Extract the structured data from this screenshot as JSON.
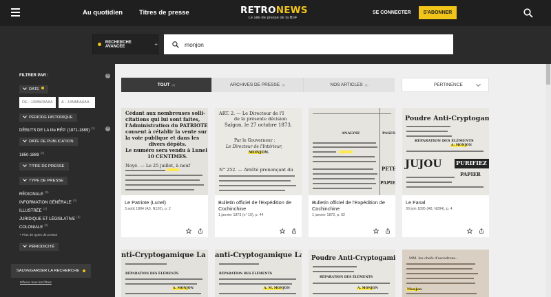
{
  "header": {
    "nav_daily": "Au quotidien",
    "nav_titles": "Titres de presse",
    "logo_retro": "RETRO",
    "logo_news": "NEWS",
    "logo_sub": "Le site de presse de la BnF",
    "connect": "SE CONNECTER",
    "subscribe": "S'ABONNER",
    "icons": [
      "menu-icon",
      "search-icon"
    ],
    "accent": "#f0c419"
  },
  "search": {
    "advanced_label": "RECHERCHE AVANCÉE",
    "advanced_plus": "+",
    "query": "monjon"
  },
  "sidebar": {
    "filter_by": "FILTRER PAR :",
    "date_pill": "DATE",
    "date_from_placeholder": "DE : JJ/MM/AAAA",
    "date_to_placeholder": "À : JJ/MM/AAAA",
    "period_pill": "PÉRIODE HISTORIQUE",
    "period_selected": "DÉBUTS DE LA IIIe RÉP. (1871-1889)",
    "period_selected_count": "(1)",
    "pub_date_pill": "DATE DE PUBLICATION",
    "pub_date_range": "1850-1889",
    "pub_date_count": "(6)",
    "press_title_pill": "TITRE DE PRESSE",
    "press_type_pill": "TYPE DE PRESSE",
    "press_types": [
      {
        "label": "RÉGIONALE",
        "count": "(5)"
      },
      {
        "label": "INFORMATION GÉNÉRALE",
        "count": "(4)"
      },
      {
        "label": "ILLUSTRÉE",
        "count": "(4)"
      },
      {
        "label": "JURIDIQUE ET LÉGISLATIVE",
        "count": "(2)"
      },
      {
        "label": "COLONIALE",
        "count": "(2)"
      }
    ],
    "more_types": "+  Plus de types de presse",
    "periodicity_pill": "PÉRIODICITÉ",
    "save_search": "SAUVEGARDER LA RECHERCHE",
    "clear_filters": "Effacer tous les filtres"
  },
  "tabs": [
    {
      "label": "TOUT",
      "count": "(6)",
      "active": true
    },
    {
      "label": "ARCHIVES DE PRESSE",
      "count": "(6)",
      "active": false
    },
    {
      "label": "NOS ARTICLES",
      "count": "(0)",
      "active": false
    }
  ],
  "sort": {
    "label": "PERTINENCE"
  },
  "results": [
    {
      "title": "Le Patriote (Lunel)",
      "meta": "3 août 1884 (A3, N120), p. 2"
    },
    {
      "title": "Bulletin officiel de l'Expédition de Cochinchine",
      "meta": "1 janvier 1873 (n° 10), p. 44"
    },
    {
      "title": "Bulletin officiel de l'Expédition de Cochinchine",
      "meta": "1 janvier 1872, p. 92"
    },
    {
      "title": "Le Fanal",
      "meta": "30 juin 1895 (A8, N284), p. 4"
    }
  ],
  "thumb_text": {
    "t1": [
      "Cédant aux nombreuses solli-",
      "citations qui lui sont faites,",
      "l'Administration du PATRIOTE",
      "consent à rétablir la vente sur",
      "la voie publique et dans les",
      "divers dépôts.",
      "Le numéro sera vendu à Lunel",
      "10 CENTIMES.",
      "Noyé. — Le 25 juillet, à neuf",
      "Monjon"
    ],
    "t2": [
      "ART. 2. — Le Directeur de l'I",
      "de la présente décision",
      "Saïgon, le 27 octobre 1873.",
      "Par le Gouverneur :",
      "Le Directeur de l'Intérieur,",
      "MONJON.",
      "N° 252. — Arrêté prononçant du",
      "ANALYSE"
    ],
    "t3": [
      "ANALYSE",
      "PAGES",
      "Monjon",
      "PETERIE",
      "PAPIER"
    ],
    "t4": [
      "Poudre Anti-Cryptogamique",
      "RÉPARATION DES ÉLÉMENTS",
      "A. MONJON",
      "JUJOU",
      "PURIFIEZ",
      "PAPIER"
    ],
    "b1": [
      "nti-Cryptogamique La",
      "RÉPARATION DES ÉLÉMENTS",
      "A. MONJON"
    ],
    "b2": [
      "anti-Cryptogamique Lau",
      "RÉPARATION DES ÉLÉMENTS",
      "A. M. MONJON"
    ],
    "b3": [
      "Poudre Anti-Cryptogamique",
      "RÉPARATION DES ÉLÉMENTS",
      "A. MONJON"
    ],
    "b4": [
      "MM. les chefs d'escadrons :",
      "Monjon"
    ]
  }
}
